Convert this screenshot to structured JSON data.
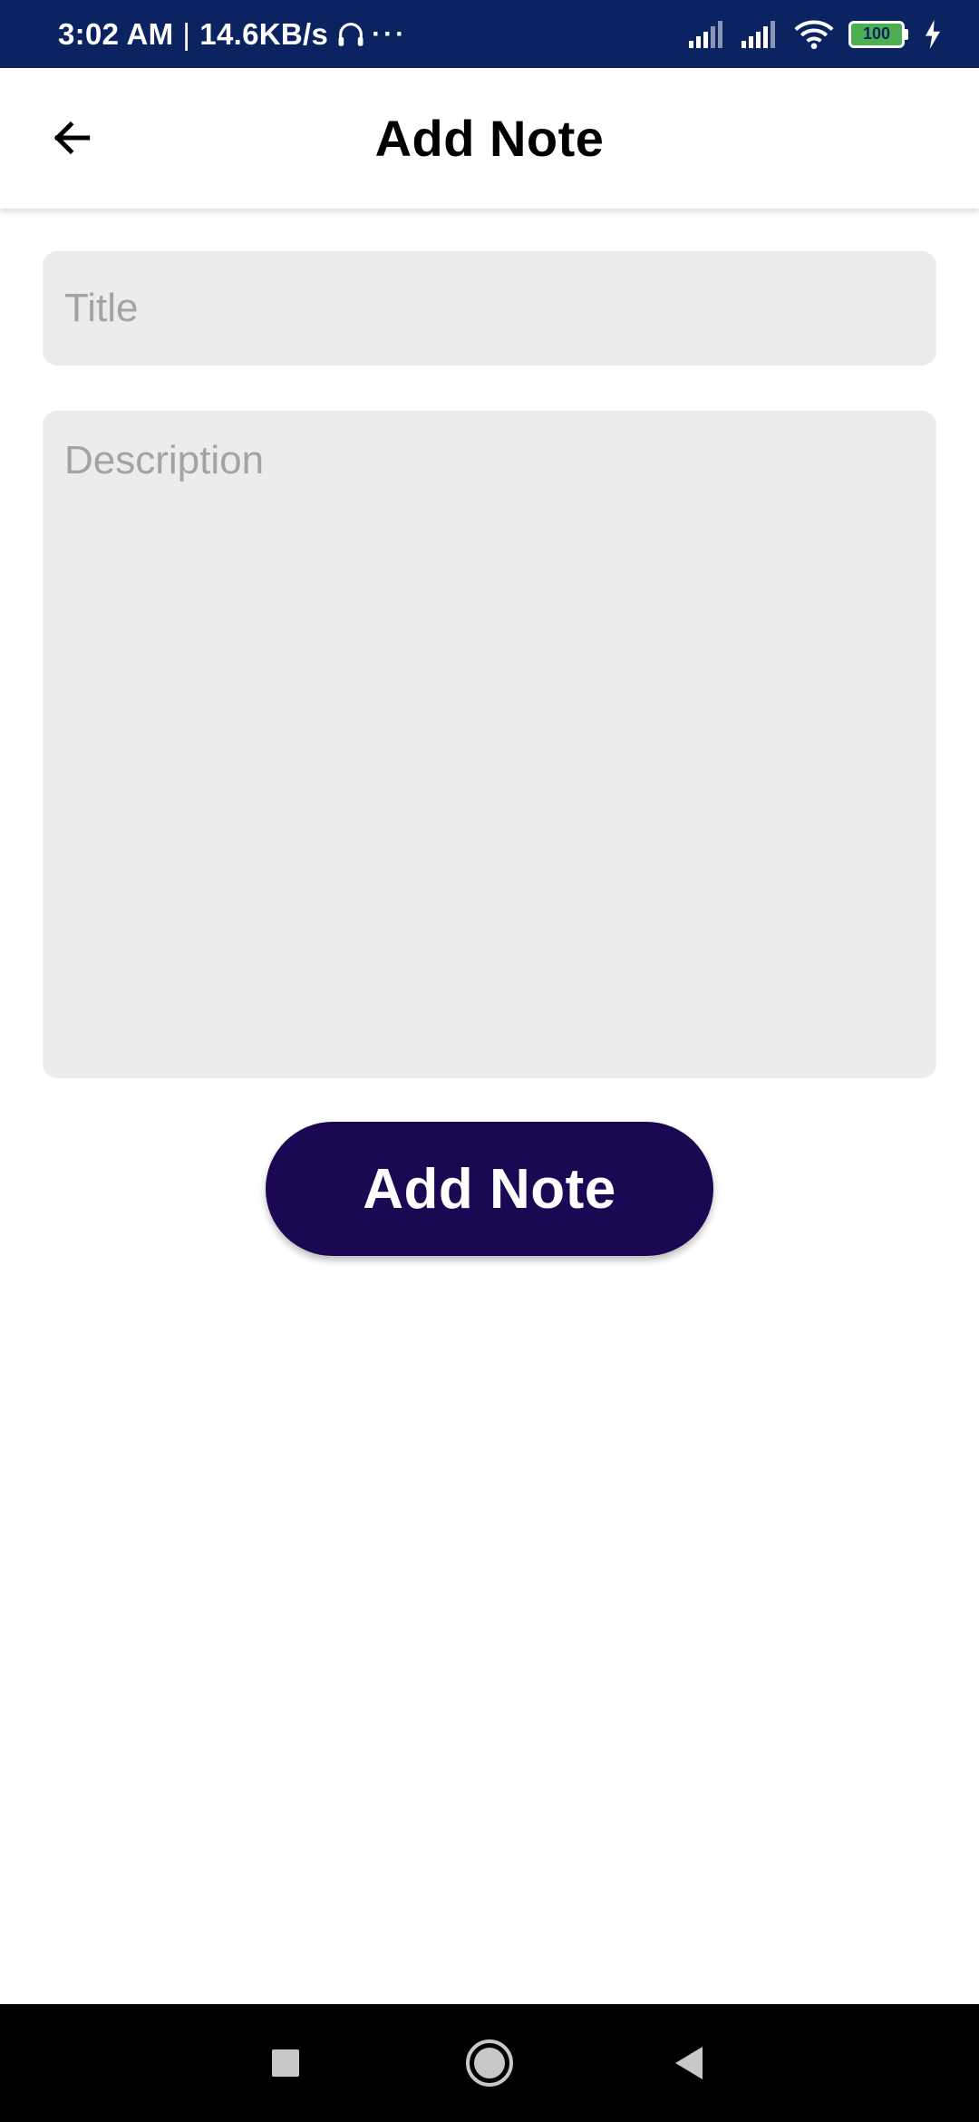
{
  "status_bar": {
    "time": "3:02 AM",
    "separator": "|",
    "network_speed": "14.6KB/s",
    "more": "···",
    "battery_level": "100",
    "icons": [
      "headphones-icon",
      "signal-icon",
      "signal-icon",
      "wifi-icon",
      "battery-icon",
      "charging-icon"
    ],
    "background_color": "#0b2461"
  },
  "app_bar": {
    "title": "Add Note",
    "back_icon": "arrow-left-icon"
  },
  "form": {
    "title_placeholder": "Title",
    "title_value": "",
    "description_placeholder": "Description",
    "description_value": "",
    "field_color": "#ececec"
  },
  "actions": {
    "add_note_label": "Add Note",
    "button_color": "#1a0852"
  },
  "nav_bar": {
    "icons": [
      "recents-square-icon",
      "home-circle-icon",
      "back-triangle-icon"
    ]
  }
}
